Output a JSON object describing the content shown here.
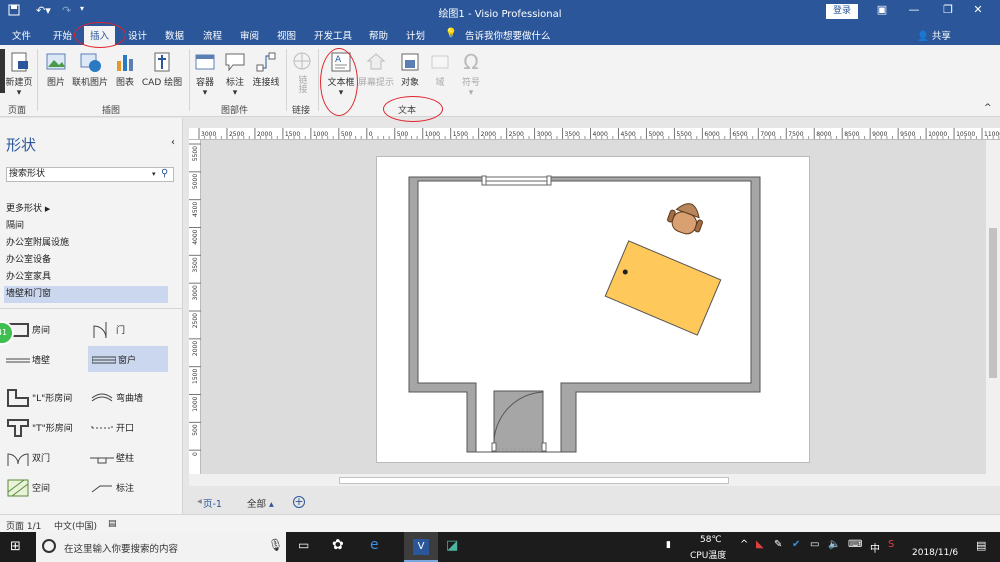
{
  "app": {
    "title": "绘图1  -  Visio Professional",
    "login": "登录"
  },
  "tabs": [
    {
      "label": "文件"
    },
    {
      "label": "开始"
    },
    {
      "label": "插入"
    },
    {
      "label": "设计"
    },
    {
      "label": "数据"
    },
    {
      "label": "流程"
    },
    {
      "label": "审阅"
    },
    {
      "label": "视图"
    },
    {
      "label": "开发工具"
    },
    {
      "label": "帮助"
    },
    {
      "label": "计划"
    }
  ],
  "tellme": "告诉我你想要做什么",
  "share": "共享",
  "ribbon": {
    "buttons": [
      {
        "label": "新建页"
      },
      {
        "label": "图片"
      },
      {
        "label": "联机图片"
      },
      {
        "label": "图表"
      },
      {
        "label": "CAD 绘图"
      },
      {
        "label": "容器"
      },
      {
        "label": "标注"
      },
      {
        "label": "连接线"
      },
      {
        "label": "链接"
      },
      {
        "label": "文本框"
      },
      {
        "label": "屏幕提示"
      },
      {
        "label": "对象"
      },
      {
        "label": "域"
      },
      {
        "label": "符号"
      }
    ],
    "groups": [
      "页面",
      "插图",
      "图部件",
      "链接",
      "文本"
    ]
  },
  "shapes_panel": {
    "title": "形状",
    "search_placeholder": "搜索形状",
    "more_shapes": "更多形状",
    "stencils": [
      "隔间",
      "办公室附属设施",
      "办公室设备",
      "办公室家具",
      "墙壁和门窗"
    ],
    "shapes": [
      {
        "label": "房间"
      },
      {
        "label": "门"
      },
      {
        "label": "墙壁"
      },
      {
        "label": "窗户"
      },
      {
        "label": "\"L\"形房间"
      },
      {
        "label": "弯曲墙"
      },
      {
        "label": "\"T\"形房间"
      },
      {
        "label": "开口"
      },
      {
        "label": "双门"
      },
      {
        "label": "壁柱"
      },
      {
        "label": "空间"
      },
      {
        "label": "标注"
      }
    ],
    "badge": "41"
  },
  "ruler": {
    "top_ticks": [
      "3000",
      "2500",
      "2000",
      "1500",
      "1000",
      "500",
      "0",
      "500",
      "1000",
      "1500",
      "2000",
      "2500",
      "3000",
      "3500",
      "4000",
      "4500",
      "5000",
      "5500",
      "6000",
      "6500",
      "7000",
      "7500",
      "8000",
      "8500",
      "9000",
      "9500",
      "10000",
      "10500",
      "11000"
    ],
    "left_ticks": [
      "5500",
      "5000",
      "4500",
      "4000",
      "3500",
      "3000",
      "2500",
      "2000",
      "1500",
      "1000",
      "500",
      "0"
    ]
  },
  "page_tabs": {
    "page": "页-1",
    "all": "全部"
  },
  "status": {
    "page": "页面 1/1",
    "lang": "中文(中国)"
  },
  "taskbar": {
    "search": "在这里输入你要搜索的内容",
    "temp": "58℃",
    "cpu": "CPU温度",
    "ime": "中",
    "time": "2018/11/6"
  },
  "colors": {
    "ribbon_blue": "#2b579a",
    "wall_gray": "#a6a6a6",
    "desk_orange": "#ffc85a",
    "chair_brown": "#b9855a",
    "annotation_red": "#e0242c"
  }
}
